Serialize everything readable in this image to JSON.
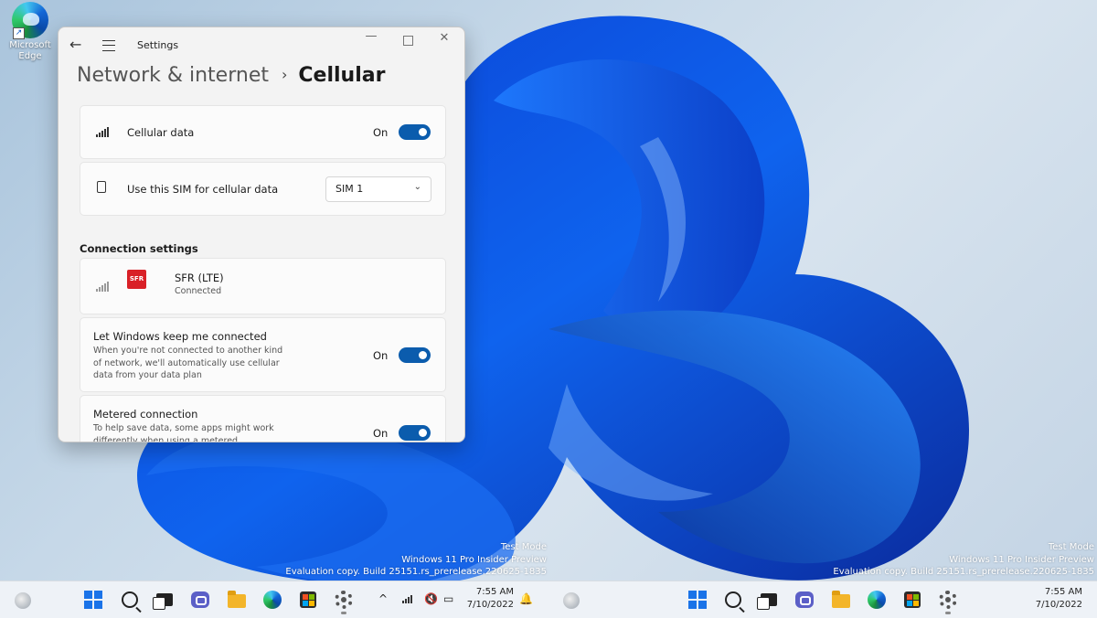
{
  "desktop": {
    "icons": [
      {
        "label": "Microsoft Edge"
      }
    ],
    "watermark_left": [
      "Test Mode",
      "Windows 11 Pro Insider Preview",
      "Evaluation copy. Build 25151.rs_prerelease.220625-1835"
    ],
    "watermark_right": [
      "Test Mode",
      "Windows 11 Pro Insider Preview",
      "Evaluation copy. Build 25151.rs_prerelease.220625-1835"
    ]
  },
  "window": {
    "title": "Settings",
    "breadcrumb": {
      "parent": "Network & internet",
      "separator": "›",
      "current": "Cellular"
    }
  },
  "cellular_data": {
    "label": "Cellular data",
    "state": "On",
    "icon": "signal-bars-icon"
  },
  "sim": {
    "label": "Use this SIM for cellular data",
    "selected": "SIM 1",
    "icon": "sim-icon"
  },
  "connection_settings": {
    "heading": "Connection settings",
    "network": {
      "name": "SFR (LTE)",
      "status": "Connected",
      "badge": "SFR"
    },
    "keep_connected": {
      "title": "Let Windows keep me connected",
      "desc": [
        "When you're not connected to another kind",
        "of network, we'll automatically use cellular",
        "data from your data plan"
      ],
      "state": "On"
    },
    "metered": {
      "title": "Metered connection",
      "desc": [
        "To help save data, some apps might work",
        "differently when using a metered"
      ],
      "state": "On"
    }
  },
  "taskbar": {
    "time": "7:55 AM",
    "date": "7/10/2022",
    "time2": "7:55 AM",
    "date2": "7/10/2022",
    "tray_chevron": "^"
  }
}
